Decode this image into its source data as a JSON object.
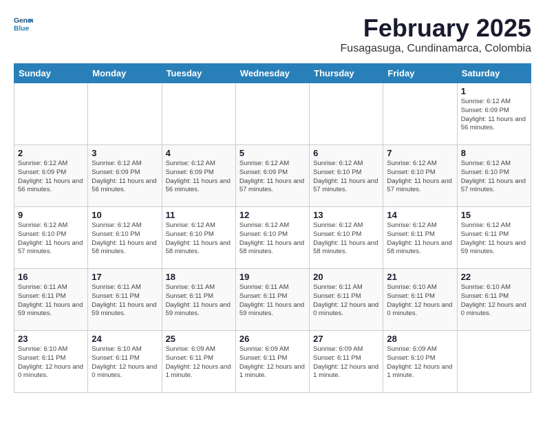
{
  "header": {
    "logo_line1": "General",
    "logo_line2": "Blue",
    "title": "February 2025",
    "subtitle": "Fusagasuga, Cundinamarca, Colombia"
  },
  "days_of_week": [
    "Sunday",
    "Monday",
    "Tuesday",
    "Wednesday",
    "Thursday",
    "Friday",
    "Saturday"
  ],
  "weeks": [
    [
      {
        "day": "",
        "info": ""
      },
      {
        "day": "",
        "info": ""
      },
      {
        "day": "",
        "info": ""
      },
      {
        "day": "",
        "info": ""
      },
      {
        "day": "",
        "info": ""
      },
      {
        "day": "",
        "info": ""
      },
      {
        "day": "1",
        "info": "Sunrise: 6:12 AM\nSunset: 6:09 PM\nDaylight: 11 hours\nand 56 minutes."
      }
    ],
    [
      {
        "day": "2",
        "info": "Sunrise: 6:12 AM\nSunset: 6:09 PM\nDaylight: 11 hours\nand 56 minutes."
      },
      {
        "day": "3",
        "info": "Sunrise: 6:12 AM\nSunset: 6:09 PM\nDaylight: 11 hours\nand 56 minutes."
      },
      {
        "day": "4",
        "info": "Sunrise: 6:12 AM\nSunset: 6:09 PM\nDaylight: 11 hours\nand 56 minutes."
      },
      {
        "day": "5",
        "info": "Sunrise: 6:12 AM\nSunset: 6:09 PM\nDaylight: 11 hours\nand 57 minutes."
      },
      {
        "day": "6",
        "info": "Sunrise: 6:12 AM\nSunset: 6:10 PM\nDaylight: 11 hours\nand 57 minutes."
      },
      {
        "day": "7",
        "info": "Sunrise: 6:12 AM\nSunset: 6:10 PM\nDaylight: 11 hours\nand 57 minutes."
      },
      {
        "day": "8",
        "info": "Sunrise: 6:12 AM\nSunset: 6:10 PM\nDaylight: 11 hours\nand 57 minutes."
      }
    ],
    [
      {
        "day": "9",
        "info": "Sunrise: 6:12 AM\nSunset: 6:10 PM\nDaylight: 11 hours\nand 57 minutes."
      },
      {
        "day": "10",
        "info": "Sunrise: 6:12 AM\nSunset: 6:10 PM\nDaylight: 11 hours\nand 58 minutes."
      },
      {
        "day": "11",
        "info": "Sunrise: 6:12 AM\nSunset: 6:10 PM\nDaylight: 11 hours\nand 58 minutes."
      },
      {
        "day": "12",
        "info": "Sunrise: 6:12 AM\nSunset: 6:10 PM\nDaylight: 11 hours\nand 58 minutes."
      },
      {
        "day": "13",
        "info": "Sunrise: 6:12 AM\nSunset: 6:10 PM\nDaylight: 11 hours\nand 58 minutes."
      },
      {
        "day": "14",
        "info": "Sunrise: 6:12 AM\nSunset: 6:11 PM\nDaylight: 11 hours\nand 58 minutes."
      },
      {
        "day": "15",
        "info": "Sunrise: 6:12 AM\nSunset: 6:11 PM\nDaylight: 11 hours\nand 59 minutes."
      }
    ],
    [
      {
        "day": "16",
        "info": "Sunrise: 6:11 AM\nSunset: 6:11 PM\nDaylight: 11 hours\nand 59 minutes."
      },
      {
        "day": "17",
        "info": "Sunrise: 6:11 AM\nSunset: 6:11 PM\nDaylight: 11 hours\nand 59 minutes."
      },
      {
        "day": "18",
        "info": "Sunrise: 6:11 AM\nSunset: 6:11 PM\nDaylight: 11 hours\nand 59 minutes."
      },
      {
        "day": "19",
        "info": "Sunrise: 6:11 AM\nSunset: 6:11 PM\nDaylight: 11 hours\nand 59 minutes."
      },
      {
        "day": "20",
        "info": "Sunrise: 6:11 AM\nSunset: 6:11 PM\nDaylight: 12 hours\nand 0 minutes."
      },
      {
        "day": "21",
        "info": "Sunrise: 6:10 AM\nSunset: 6:11 PM\nDaylight: 12 hours\nand 0 minutes."
      },
      {
        "day": "22",
        "info": "Sunrise: 6:10 AM\nSunset: 6:11 PM\nDaylight: 12 hours\nand 0 minutes."
      }
    ],
    [
      {
        "day": "23",
        "info": "Sunrise: 6:10 AM\nSunset: 6:11 PM\nDaylight: 12 hours\nand 0 minutes."
      },
      {
        "day": "24",
        "info": "Sunrise: 6:10 AM\nSunset: 6:11 PM\nDaylight: 12 hours\nand 0 minutes."
      },
      {
        "day": "25",
        "info": "Sunrise: 6:09 AM\nSunset: 6:11 PM\nDaylight: 12 hours\nand 1 minute."
      },
      {
        "day": "26",
        "info": "Sunrise: 6:09 AM\nSunset: 6:11 PM\nDaylight: 12 hours\nand 1 minute."
      },
      {
        "day": "27",
        "info": "Sunrise: 6:09 AM\nSunset: 6:11 PM\nDaylight: 12 hours\nand 1 minute."
      },
      {
        "day": "28",
        "info": "Sunrise: 6:09 AM\nSunset: 6:10 PM\nDaylight: 12 hours\nand 1 minute."
      },
      {
        "day": "",
        "info": ""
      }
    ]
  ]
}
